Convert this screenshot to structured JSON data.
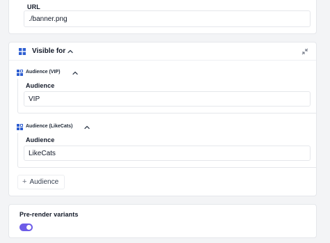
{
  "url_section": {
    "label": "URL",
    "value": "./banner.png"
  },
  "visible_for": {
    "title": "Visible for",
    "icons": {
      "section": "grid-icon",
      "toggle": "chevron-up-icon",
      "collapse": "collapse-icon",
      "group": "audience-group-icon"
    },
    "groups": [
      {
        "label": "Audience (VIP)",
        "field_label": "Audience",
        "value": "VIP"
      },
      {
        "label": "Audience (LikeCats)",
        "field_label": "Audience",
        "value": "LikeCats"
      }
    ],
    "add_label": "Audience"
  },
  "prerender": {
    "label": "Pre-render variants",
    "enabled": true
  },
  "colors": {
    "accent": "#6d5ce8",
    "icon_blue": "#2f5fd1",
    "border": "#e5e7eb",
    "background": "#f3f4f6"
  }
}
